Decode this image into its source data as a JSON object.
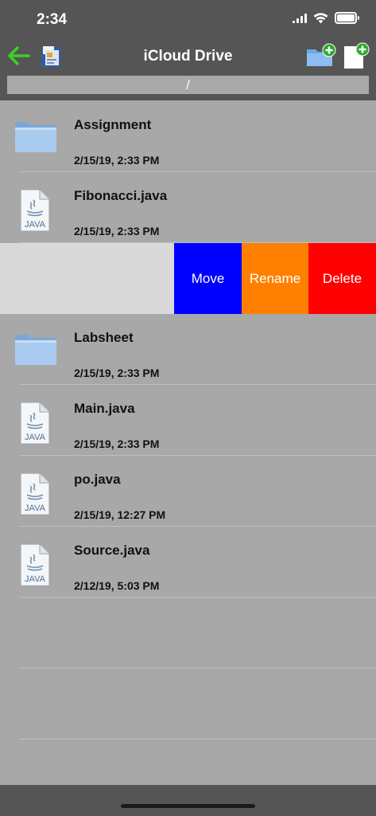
{
  "status_bar": {
    "time": "2:34"
  },
  "nav": {
    "title": "iCloud Drive",
    "back_icon": "arrow-left-icon",
    "app_icon": "file-manager-app-icon",
    "new_folder_icon": "new-folder-icon",
    "new_file_icon": "new-file-icon",
    "accent_color": "#3ecf2a"
  },
  "path": "/",
  "rows": [
    {
      "name": "Assignment",
      "date": "2/15/19, 2:33 PM",
      "kind": "folder"
    },
    {
      "name": "Fibonacci.java",
      "date": "2/15/19, 2:33 PM",
      "kind": "java"
    },
    {
      "name": "Labsheet",
      "date": "2/15/19, 2:33 PM",
      "kind": "folder"
    },
    {
      "name": "Main.java",
      "date": "2/15/19, 2:33 PM",
      "kind": "java"
    },
    {
      "name": "po.java",
      "date": "2/15/19, 12:27 PM",
      "kind": "java"
    },
    {
      "name": "Source.java",
      "date": "2/12/19, 5:03 PM",
      "kind": "java"
    }
  ],
  "java_badge": "JAVA",
  "swipe_actions": {
    "move": {
      "label": "Move",
      "color": "#0000ff"
    },
    "rename": {
      "label": "Rename",
      "color": "#ff8000"
    },
    "delete": {
      "label": "Delete",
      "color": "#ff0000"
    }
  }
}
